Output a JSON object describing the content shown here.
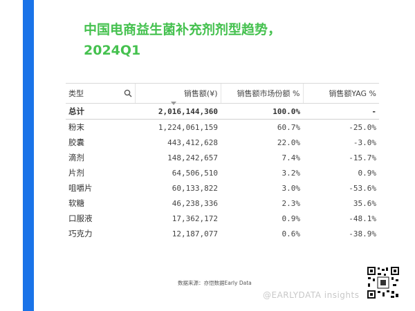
{
  "title": "中国电商益生菌补充剂剂型趋势，2024Q1",
  "table": {
    "headers": [
      "类型",
      "销售额(¥)",
      "销售额市场份额 %",
      "销售额YAG %"
    ],
    "total": {
      "type": "总计",
      "sales": "2,016,144,360",
      "share": "100.0%",
      "yag": "-"
    },
    "rows": [
      {
        "type": "粉末",
        "sales": "1,224,061,159",
        "share": "60.7%",
        "yag": "-25.0%"
      },
      {
        "type": "胶囊",
        "sales": "443,412,628",
        "share": "22.0%",
        "yag": "-3.0%"
      },
      {
        "type": "滴剂",
        "sales": "148,242,657",
        "share": "7.4%",
        "yag": "-15.7%"
      },
      {
        "type": "片剂",
        "sales": "64,506,510",
        "share": "3.2%",
        "yag": "0.9%"
      },
      {
        "type": "咀嚼片",
        "sales": "60,133,822",
        "share": "3.0%",
        "yag": "-53.6%"
      },
      {
        "type": "软糖",
        "sales": "46,238,336",
        "share": "2.3%",
        "yag": "35.6%"
      },
      {
        "type": "口服液",
        "sales": "17,362,172",
        "share": "0.9%",
        "yag": "-48.1%"
      },
      {
        "type": "巧克力",
        "sales": "12,187,077",
        "share": "0.6%",
        "yag": "-38.9%"
      }
    ]
  },
  "source": "数据来源：亦恺数据Early Data",
  "watermark": "@EARLYDATA insights",
  "colors": {
    "title": "#45c14f",
    "accent_bar": "#1a73e8"
  }
}
